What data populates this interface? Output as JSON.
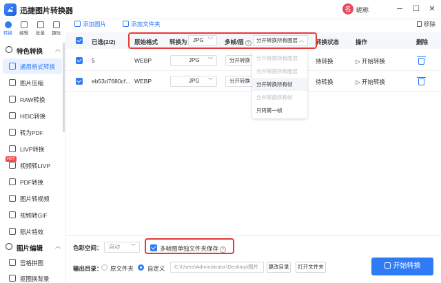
{
  "app": {
    "title": "迅捷图片转换器",
    "user_avatar": "名",
    "user_name": "昵称"
  },
  "window": {
    "minimize": "─",
    "maximize": "☐",
    "close": "✕"
  },
  "rail": [
    {
      "label": "转换",
      "active": true
    },
    {
      "label": "编辑",
      "active": false
    },
    {
      "label": "批量",
      "active": false
    },
    {
      "label": "趣玩",
      "active": false
    }
  ],
  "sidebar": {
    "sections": [
      {
        "title": "特色转换",
        "items": [
          {
            "label": "通用格式转换",
            "active": true
          },
          {
            "label": "图片压缩"
          },
          {
            "label": "RAW转换"
          },
          {
            "label": "HEIC转换"
          },
          {
            "label": "转为PDF"
          },
          {
            "label": "LIVP转换"
          },
          {
            "label": "视频转LIVP",
            "badge": "HOT"
          },
          {
            "label": "PDF转换"
          },
          {
            "label": "图片转视频"
          },
          {
            "label": "视频转GIF"
          },
          {
            "label": "照片特效"
          }
        ]
      },
      {
        "title": "图片编辑",
        "items": [
          {
            "label": "宫格拼图"
          },
          {
            "label": "抠图换背景"
          }
        ]
      }
    ]
  },
  "toolbar": {
    "add_image": "添加图片",
    "add_folder": "添加文件夹",
    "remove": "移除"
  },
  "table": {
    "headers": {
      "selected": "已选(2/2)",
      "original_format": "原始格式",
      "convert_to": "转换为",
      "convert_to_value": "JPG",
      "multi_frame": "多帧/层",
      "multi_frame_value": "分开转换所有图层",
      "status": "转换状态",
      "action": "操作",
      "delete": "删除"
    },
    "rows": [
      {
        "name": "5",
        "format": "WEBP",
        "target": "JPG",
        "frame_option": "分开转换",
        "status": "待转换",
        "action": "开始转换"
      },
      {
        "name": "eb53d7680cf...",
        "format": "WEBP",
        "target": "JPG",
        "frame_option": "分开转换",
        "status": "待转换",
        "action": "开始转换"
      }
    ]
  },
  "dropdown": {
    "options": [
      {
        "label": "分开转换所有图层",
        "state": "disabled"
      },
      {
        "label": "合并转换所有图层",
        "state": "disabled"
      },
      {
        "label": "分开转换所有帧",
        "state": "active"
      },
      {
        "label": "合并转换所有帧",
        "state": "disabled"
      },
      {
        "label": "只转第一帧",
        "state": "normal"
      }
    ]
  },
  "bottom": {
    "color_space_label": "色彩空间：",
    "color_space_value": "自动",
    "multi_frame_folder_label": "多帧图单独文件夹保存",
    "multi_frame_folder_checked": true,
    "output_dir_label": "输出目录：",
    "original_folder_label": "原文件夹",
    "custom_label": "自定义",
    "path_value": "C:\\Users\\Administrator\\Desktop\\图片",
    "change_dir": "更改目录",
    "open_folder": "打开文件夹",
    "convert_button": "开始转换"
  },
  "colors": {
    "accent": "#2f7bf6",
    "highlight": "#e53935"
  }
}
